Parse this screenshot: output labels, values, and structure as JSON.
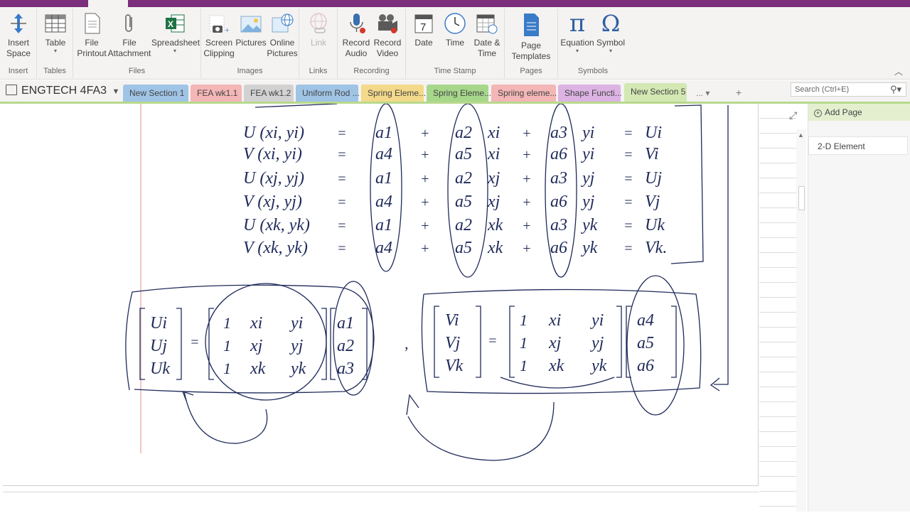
{
  "ribbon": {
    "groups": [
      {
        "label": "Insert",
        "buttons": [
          {
            "label": "Insert\nSpace",
            "icon": "insert-space-icon"
          }
        ]
      },
      {
        "label": "Tables",
        "buttons": [
          {
            "label": "Table",
            "icon": "table-icon"
          }
        ]
      },
      {
        "label": "Files",
        "buttons": [
          {
            "label": "File\nPrintout",
            "icon": "file-printout-icon"
          },
          {
            "label": "File\nAttachment",
            "icon": "paperclip-icon"
          },
          {
            "label": "Spreadsheet",
            "icon": "excel-icon"
          }
        ]
      },
      {
        "label": "Images",
        "buttons": [
          {
            "label": "Screen\nClipping",
            "icon": "camera-icon"
          },
          {
            "label": "Pictures",
            "icon": "picture-icon"
          },
          {
            "label": "Online\nPictures",
            "icon": "online-picture-icon"
          }
        ]
      },
      {
        "label": "Links",
        "buttons": [
          {
            "label": "Link",
            "icon": "link-icon"
          }
        ]
      },
      {
        "label": "Recording",
        "buttons": [
          {
            "label": "Record\nAudio",
            "icon": "microphone-icon"
          },
          {
            "label": "Record\nVideo",
            "icon": "video-camera-icon"
          }
        ]
      },
      {
        "label": "Time Stamp",
        "buttons": [
          {
            "label": "Date",
            "icon": "calendar-icon"
          },
          {
            "label": "Time",
            "icon": "clock-icon"
          },
          {
            "label": "Date &\nTime",
            "icon": "date-time-icon"
          }
        ]
      },
      {
        "label": "Pages",
        "buttons": [
          {
            "label": "Page\nTemplates",
            "icon": "page-template-icon"
          }
        ]
      },
      {
        "label": "Symbols",
        "buttons": [
          {
            "label": "Equation",
            "icon": "pi-icon",
            "glyph": "π"
          },
          {
            "label": "Symbol",
            "icon": "omega-icon",
            "glyph": "Ω"
          }
        ]
      }
    ]
  },
  "notebook": {
    "name": "ENGTECH 4FA3"
  },
  "sections": [
    {
      "label": "New Section 1",
      "color": "#9fc4e6"
    },
    {
      "label": "FEA wk1.1",
      "color": "#f4b6b6"
    },
    {
      "label": "FEA wk1.2",
      "color": "#d2d2d2"
    },
    {
      "label": "Uniform Rod ...",
      "color": "#9fc4e6"
    },
    {
      "label": "Spring Eleme...",
      "color": "#f3d98a"
    },
    {
      "label": "Spring Eleme...",
      "color": "#a7d78a"
    },
    {
      "label": "Spriing eleme...",
      "color": "#f4b6b6"
    },
    {
      "label": "Shape Functi...",
      "color": "#dcb3e3"
    },
    {
      "label": "New Section 5",
      "color": "#d3e8b3"
    }
  ],
  "tabbar": {
    "more": "...",
    "add": "+"
  },
  "search": {
    "placeholder": "Search (Ctrl+E)"
  },
  "pages": {
    "add_label": "Add Page",
    "items": [
      "2-D Element"
    ]
  },
  "colors": {
    "accent": "#7b2e7c",
    "ink": "#1f2a5a",
    "active_section": "#d3e8b3"
  },
  "note": {
    "equations": [
      {
        "lhs": "U (xi, yi)",
        "a1": "a1",
        "a2": "a2",
        "x": "xi",
        "a3": "a3",
        "y": "yi",
        "rhs": "Ui"
      },
      {
        "lhs": "V (xi, yi)",
        "a1": "a4",
        "a2": "a5",
        "x": "xi",
        "a3": "a6",
        "y": "yi",
        "rhs": "Vi"
      },
      {
        "lhs": "U (xj, yj)",
        "a1": "a1",
        "a2": "a2",
        "x": "xj",
        "a3": "a3",
        "y": "yj",
        "rhs": "Uj"
      },
      {
        "lhs": "V (xj, yj)",
        "a1": "a4",
        "a2": "a5",
        "x": "xj",
        "a3": "a6",
        "y": "yj",
        "rhs": "Vj"
      },
      {
        "lhs": "U (xk, yk)",
        "a1": "a1",
        "a2": "a2",
        "x": "xk",
        "a3": "a3",
        "y": "yk",
        "rhs": "Uk"
      },
      {
        "lhs": "V (xk, yk)",
        "a1": "a4",
        "a2": "a5",
        "x": "xk",
        "a3": "a6",
        "y": "yk",
        "rhs": "Vk."
      }
    ],
    "matrix_u": {
      "lhs": [
        "Ui",
        "Uj",
        "Uk"
      ],
      "rows": [
        [
          "1",
          "xi",
          "yi"
        ],
        [
          "1",
          "xj",
          "yj"
        ],
        [
          "1",
          "xk",
          "yk"
        ]
      ],
      "coef": [
        "a1",
        "a2",
        "a3"
      ]
    },
    "matrix_v": {
      "lhs": [
        "Vi",
        "Vj",
        "Vk"
      ],
      "rows": [
        [
          "1",
          "xi",
          "yi"
        ],
        [
          "1",
          "xj",
          "yj"
        ],
        [
          "1",
          "xk",
          "yk"
        ]
      ],
      "coef": [
        "a4",
        "a5",
        "a6"
      ]
    }
  }
}
